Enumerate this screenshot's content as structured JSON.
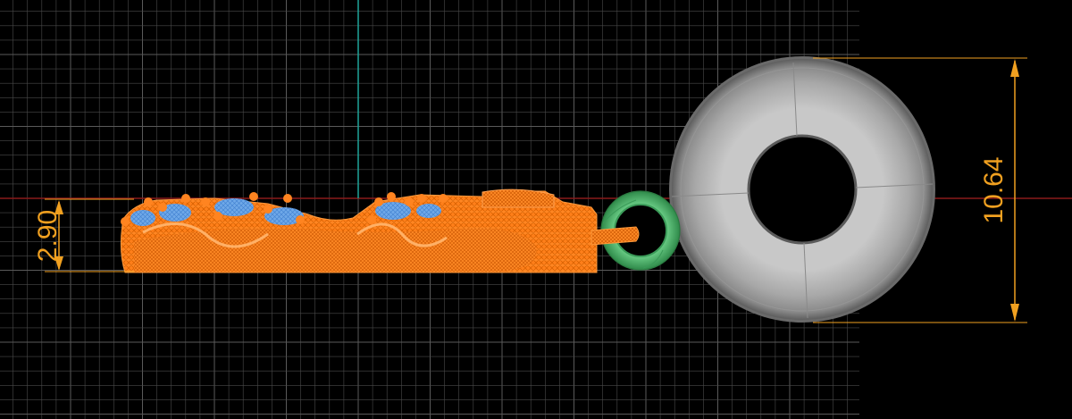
{
  "viewport": {
    "background": "#000000",
    "grid_color": "#4a4a4a",
    "grid_major_color": "#5a5a5a",
    "axis_x_color": "#8a1a1a",
    "axis_y_color": "#1fa59a"
  },
  "dimensions": {
    "height_small": "2.90",
    "height_large": "10.64",
    "color": "#f0a020"
  },
  "models": {
    "pendant_body": {
      "color": "#ff7f1a",
      "icon": "wireframe-mesh"
    },
    "gem_settings": {
      "color": "#6ea8e8"
    },
    "jump_ring": {
      "color": "#58c878"
    },
    "large_ring": {
      "color": "#b0b0b0"
    }
  }
}
